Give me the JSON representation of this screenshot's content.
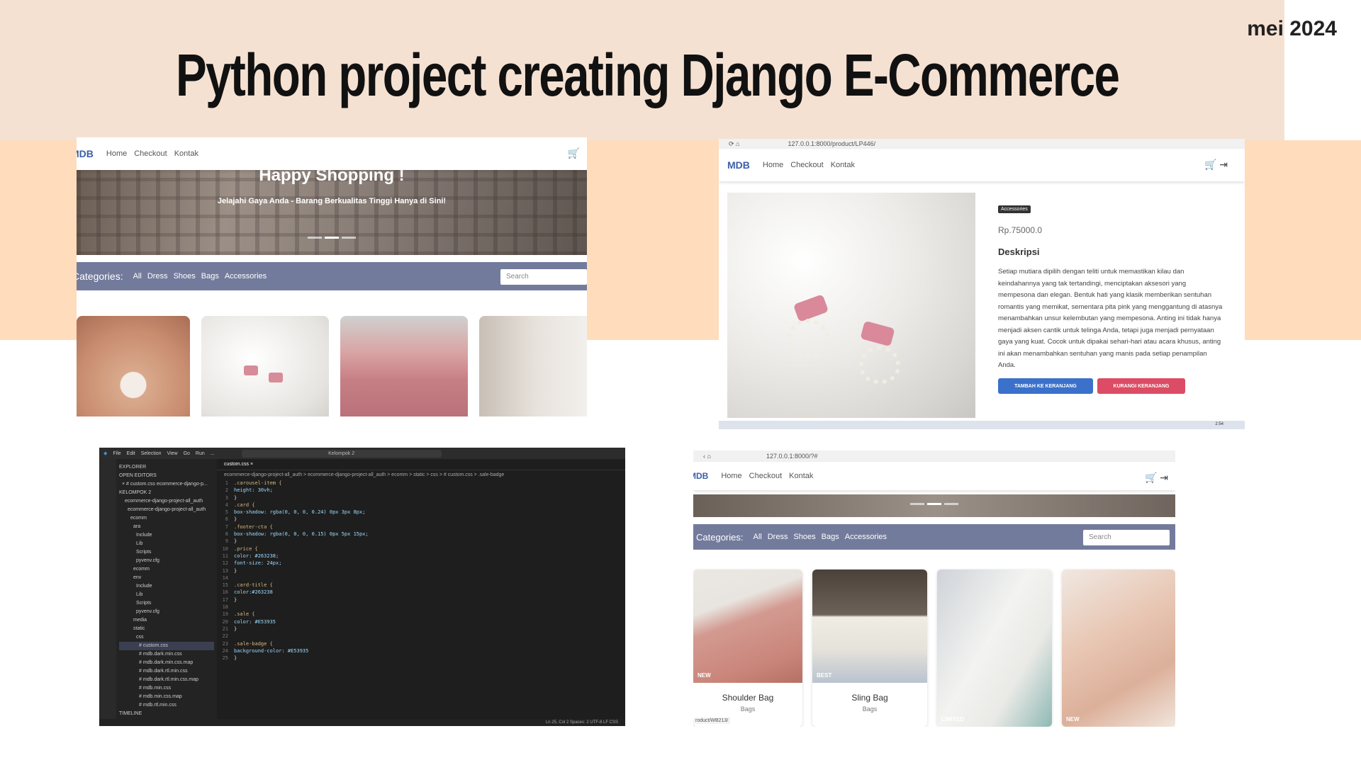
{
  "slide": {
    "title": "Python project creating Django E-Commerce",
    "date": "mei 2024"
  },
  "shop": {
    "logo": "MDB",
    "nav": [
      "Home",
      "Checkout",
      "Kontak"
    ],
    "hero_title": "Happy Shopping !",
    "hero_sub": "Jelajahi Gaya Anda - Barang Berkualitas Tinggi Hanya di Sini!",
    "categories_label": "Categories:",
    "categories": [
      "All",
      "Dress",
      "Shoes",
      "Bags",
      "Accessories"
    ],
    "search_placeholder": "Search"
  },
  "detail": {
    "url": "127.0.0.1:8000/product/LP446/",
    "badge": "Accessories",
    "price": "Rp.75000.0",
    "desc_heading": "Deskripsi",
    "description": "Setiap mutiara dipilih dengan teliti untuk memastikan kilau dan keindahannya yang tak tertandingi, menciptakan aksesori yang mempesona dan elegan. Bentuk hati yang klasik memberikan sentuhan romantis yang memikat, sementara pita pink yang menggantung di atasnya menambahkan unsur kelembutan yang mempesona. Anting ini tidak hanya menjadi aksen cantik untuk telinga Anda, tetapi juga menjadi pernyataan gaya yang kuat. Cocok untuk dipakai sehari-hari atau acara khusus, anting ini akan menambahkan sentuhan yang manis pada setiap penampilan Anda.",
    "add_btn": "TAMBAH KE KERANJANG",
    "remove_btn": "KURANGI KERANJANG",
    "clock": "2:54"
  },
  "editor": {
    "menu": [
      "File",
      "Edit",
      "Selection",
      "View",
      "Go",
      "Run",
      "..."
    ],
    "search": "Kelompok 2",
    "tab": "custom.css",
    "breadcrumb": "ecommerce-django-project-all_auth > ecommerce-django-project-all_auth > ecomm > static > css > # custom.css > .sale-badge",
    "explorer": [
      "EXPLORER",
      "OPEN EDITORS",
      "× # custom.css ecommerce-django-p...",
      "KELOMPOK 2",
      "ecommerce-django-project-all_auth",
      "ecommerce-django-project-all_auth",
      "ecomm",
      "ara",
      "Include",
      "Lib",
      "Scripts",
      "pyvenv.cfg",
      "ecomm",
      "env",
      "Include",
      "Lib",
      "Scripts",
      "pyvenv.cfg",
      "media",
      "static",
      "css",
      "# custom.css",
      "# mdb.dark.min.css",
      "# mdb.dark.min.css.map",
      "# mdb.dark.rtl.min.css",
      "# mdb.dark.rtl.min.css.map",
      "# mdb.min.css",
      "# mdb.min.css.map",
      "# mdb.rtl.min.css",
      "TIMELINE"
    ],
    "code": [
      ".carousel-item {",
      "  height: 30vh;",
      "}",
      ".card {",
      "box-shadow: rgba(0, 0, 0, 0.24) 0px 3px 8px;",
      "}",
      ".footer-cta {",
      "box-shadow: rgba(0, 0, 0, 0.15) 0px 5px 15px;",
      "}",
      ".price {",
      "color: #263238;",
      "font-size: 24px;",
      "}",
      "",
      ".card-title {",
      "color:#263238",
      "}",
      "",
      ".sale {",
      "color: #E53935",
      "}",
      "",
      ".sale-badge {",
      "background-color: #E53935",
      "}"
    ],
    "status": "Ln 25, Col 2   Spaces: 2   UTF-8   LF   CSS"
  },
  "listing": {
    "url": "127.0.0.1:8000/?#",
    "products": [
      {
        "name": "Shoulder Bag",
        "category": "Bags",
        "tag": "NEW"
      },
      {
        "name": "Sling Bag",
        "category": "Bags",
        "tag": "BEST"
      },
      {
        "name": "",
        "category": "",
        "tag": "LIMITED"
      },
      {
        "name": "",
        "category": "",
        "tag": "NEW"
      }
    ],
    "status_url": "roduct/WB213/"
  }
}
